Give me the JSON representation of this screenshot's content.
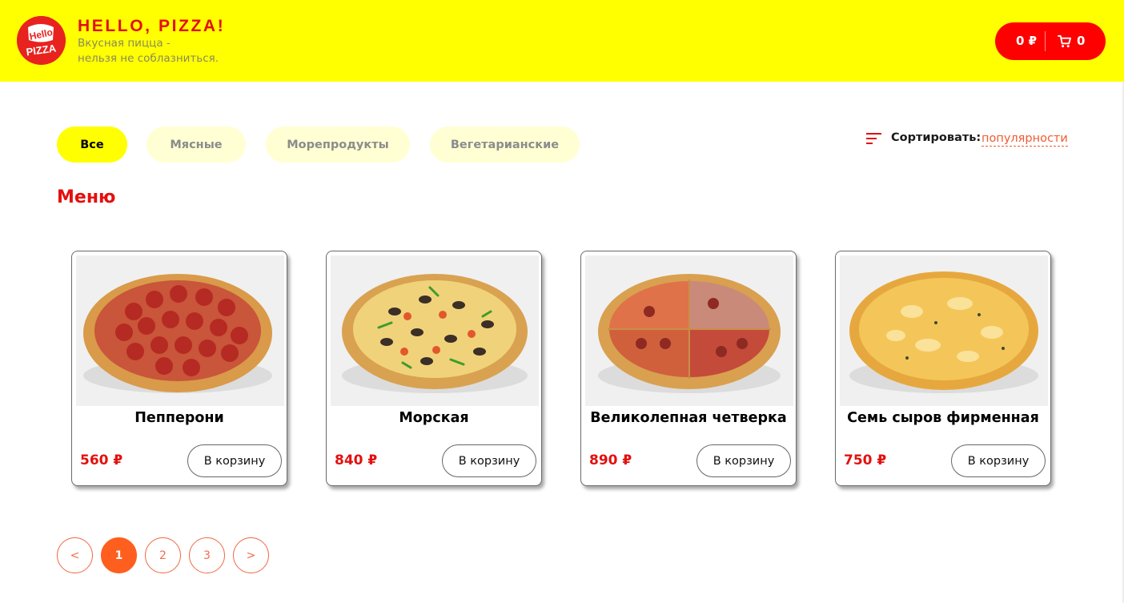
{
  "header": {
    "logo_text": "Hello PIZZA",
    "brand_title": "HELLO, PIZZA!",
    "tagline_line1": "Вкусная пицца -",
    "tagline_line2": "нельзя не соблазниться.",
    "cart": {
      "total": "0 ₽",
      "count": "0",
      "icon": "cart-icon"
    },
    "colors": {
      "background": "#ffff00",
      "accent": "#ff0000"
    }
  },
  "categories": [
    {
      "label": "Все",
      "active": true
    },
    {
      "label": "Мясные",
      "active": false
    },
    {
      "label": "Морепродукты",
      "active": false
    },
    {
      "label": "Вегетарианские",
      "active": false
    }
  ],
  "sort": {
    "label": "Сортировать:",
    "value": "популярности",
    "icon": "sort-icon"
  },
  "menu": {
    "title": "Меню",
    "add_label": "В корзину",
    "items": [
      {
        "name": "Пепперони",
        "price": "560 ₽",
        "image": "pepperoni-pizza"
      },
      {
        "name": "Морская",
        "price": "840 ₽",
        "image": "seafood-pizza"
      },
      {
        "name": "Великолепная четверка",
        "price": "890 ₽",
        "image": "four-seasons-pizza"
      },
      {
        "name": "Семь сыров фирменная",
        "price": "750 ₽",
        "image": "cheese-pizza"
      }
    ]
  },
  "pagination": {
    "prev": "<",
    "pages": [
      "1",
      "2",
      "3"
    ],
    "current": "1",
    "next": ">"
  },
  "accent_color": "#fe5f1e"
}
